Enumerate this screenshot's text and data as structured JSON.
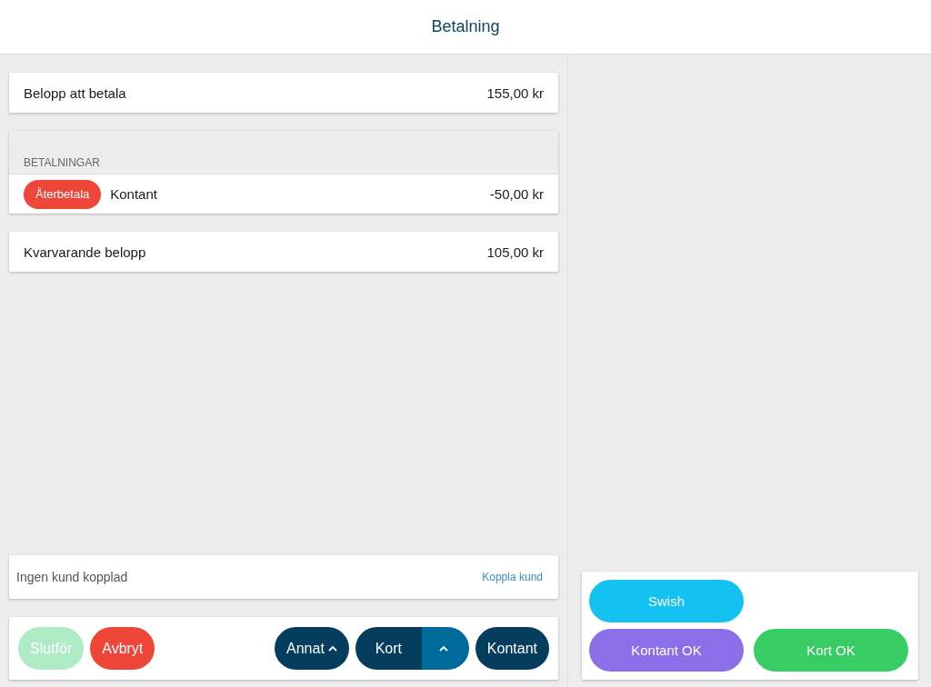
{
  "header": {
    "title": "Betalning"
  },
  "amount_due": {
    "label": "Belopp att betala",
    "value": "155,00 kr"
  },
  "payments": {
    "heading": "BETALNINGAR",
    "items": [
      {
        "action": "Återbetala",
        "method": "Kontant",
        "amount": "-50,00 kr"
      }
    ]
  },
  "remaining": {
    "label": "Kvarvarande belopp",
    "value": "105,00 kr"
  },
  "customer": {
    "text": "Ingen kund kopplad",
    "link": "Koppla kund"
  },
  "left_actions": [
    {
      "label": "Slutför",
      "kind": "finish",
      "disabled": true
    },
    {
      "label": "Avbryt",
      "kind": "cancel",
      "disabled": false
    }
  ],
  "payment_actions": [
    {
      "label": "Annat",
      "kind": "menu"
    },
    {
      "label": "Kort",
      "kind": "split"
    },
    {
      "label": "Kontant",
      "kind": "plain"
    }
  ],
  "quick_buttons": [
    {
      "label": "Swish",
      "color": "#13c2f0"
    },
    {
      "label": "Kontant OK",
      "color": "#8b6fe8"
    },
    {
      "label": "Kort OK",
      "color": "#38cc64"
    }
  ]
}
